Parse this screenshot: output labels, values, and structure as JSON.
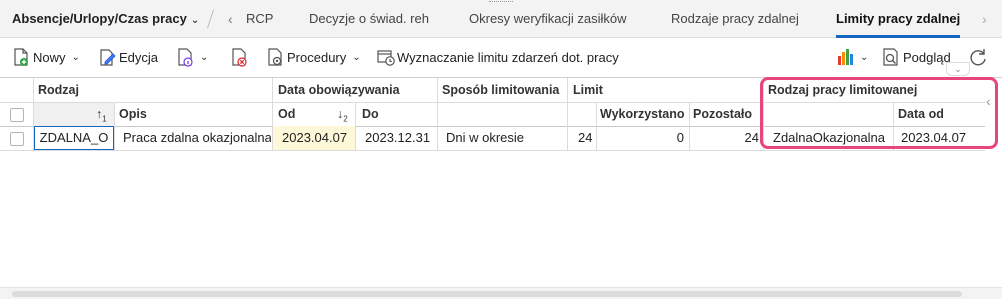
{
  "tabs": {
    "first": "Absencje/Urlopy/Czas pracy",
    "items": [
      "RCP",
      "Decyzje o świad. reh",
      "Okresy weryfikacji zasiłków",
      "Rodzaje pracy zdalnej",
      "Limity pracy zdalnej"
    ],
    "active_index": 4
  },
  "toolbar": {
    "new_label": "Nowy",
    "edit_label": "Edycja",
    "procedures_label": "Procedury",
    "limit_label": "Wyznaczanie limitu zdarzeń dot. pracy",
    "preview_label": "Podgląd"
  },
  "grid": {
    "groups": {
      "rodzaj": "Rodzaj",
      "data_obowiazywania": "Data obowiązywania",
      "sposob": "Sposób limitowania",
      "limit": "Limit",
      "rodzaj_pracy": "Rodzaj pracy limitowanej"
    },
    "columns": {
      "opis": "Opis",
      "od": "Od",
      "do": "Do",
      "wykorzystano": "Wykorzystano",
      "pozostalo": "Pozostało",
      "data_od": "Data od"
    },
    "rows": [
      {
        "rodzaj": "ZDALNA_O",
        "opis": "Praca zdalna okazjonalna",
        "od": "2023.04.07",
        "do": "2023.12.31",
        "sposob": "Dni w okresie",
        "limit": "24",
        "wykorzystano": "0",
        "pozostalo": "24",
        "rodzaj_pracy": "ZdalnaOkazjonalna",
        "data_od": "2023.04.07"
      }
    ]
  },
  "colors": {
    "accent": "#1565c0",
    "highlight": "#e8457a",
    "date_cell_bg": "#fdf8d8"
  }
}
